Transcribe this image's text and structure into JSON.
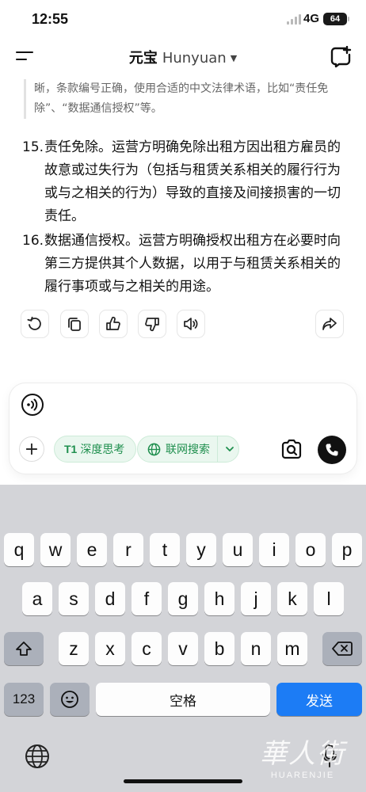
{
  "status_bar": {
    "time": "12:55",
    "network": "4G",
    "battery": "64"
  },
  "header": {
    "app_name": "元宝",
    "model": "Hunyuan"
  },
  "conversation": {
    "quote_text": "晰，条款编号正确，使用合适的中文法律术语，比如“责任免除”、“数据通信授权”等。",
    "items": [
      {
        "number": "15.",
        "text": "责任免除。运营方明确免除出租方因出租方雇员的故意或过失行为（包括与租赁关系相关的履行行为或与之相关的行为）导致的直接及间接损害的一切责任。"
      },
      {
        "number": "16.",
        "text": "数据通信授权。运营方明确授权出租方在必要时向第三方提供其个人数据，以用于与租赁关系相关的履行事项或与之相关的用途。"
      }
    ],
    "actions": [
      "refresh-icon",
      "copy-icon",
      "thumbs-up-icon",
      "thumbs-down-icon",
      "speaker-icon",
      "share-icon"
    ]
  },
  "composer": {
    "deep_think_prefix": "T1",
    "deep_think_label": "深度思考",
    "web_search_label": "联网搜索",
    "accent_color": "#1f8f4e"
  },
  "keyboard": {
    "row1": [
      "q",
      "w",
      "e",
      "r",
      "t",
      "y",
      "u",
      "i",
      "o",
      "p"
    ],
    "row2": [
      "a",
      "s",
      "d",
      "f",
      "g",
      "h",
      "j",
      "k",
      "l"
    ],
    "row3": [
      "z",
      "x",
      "c",
      "v",
      "b",
      "n",
      "m"
    ],
    "numbers_key": "123",
    "space_key": "空格",
    "send_key": "发送",
    "send_color": "#1c7cf5"
  },
  "watermark": {
    "cn": "華人街",
    "en": "HUARENJIE"
  }
}
